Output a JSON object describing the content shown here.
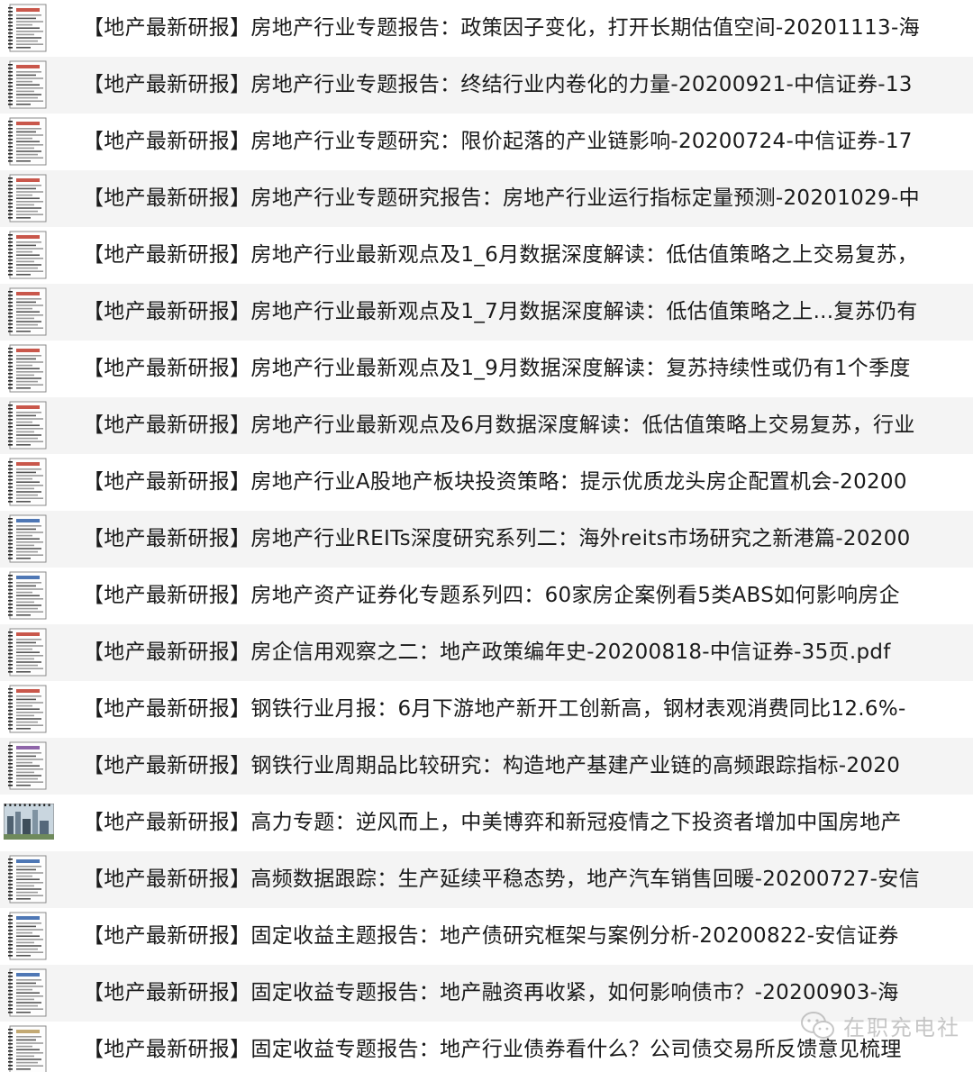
{
  "files": [
    {
      "name": "【地产最新研报】房地产行业专题报告：政策因子变化，打开长期估值空间-20201113-海",
      "thumb": "doc-red-icon"
    },
    {
      "name": "【地产最新研报】房地产行业专题报告：终结行业内卷化的力量-20200921-中信证券-13",
      "thumb": "doc-red-icon"
    },
    {
      "name": "【地产最新研报】房地产行业专题研究：限价起落的产业链影响-20200724-中信证券-17",
      "thumb": "doc-red-icon"
    },
    {
      "name": "【地产最新研报】房地产行业专题研究报告：房地产行业运行指标定量预测-20201029-中",
      "thumb": "doc-red-icon"
    },
    {
      "name": "【地产最新研报】房地产行业最新观点及1_6月数据深度解读：低估值策略之上交易复苏，",
      "thumb": "doc-red-icon"
    },
    {
      "name": "【地产最新研报】房地产行业最新观点及1_7月数据深度解读：低估值策略之上...复苏仍有",
      "thumb": "doc-red-icon"
    },
    {
      "name": "【地产最新研报】房地产行业最新观点及1_9月数据深度解读：复苏持续性或仍有1个季度",
      "thumb": "doc-red-icon"
    },
    {
      "name": "【地产最新研报】房地产行业最新观点及6月数据深度解读：低估值策略上交易复苏，行业",
      "thumb": "doc-red-icon"
    },
    {
      "name": "【地产最新研报】房地产行业A股地产板块投资策略：提示优质龙头房企配置机会-20200",
      "thumb": "doc-red-icon"
    },
    {
      "name": "【地产最新研报】房地产行业REITs深度研究系列二：海外reits市场研究之新港篇-20200",
      "thumb": "doc-blue-icon"
    },
    {
      "name": "【地产最新研报】房地产资产证券化专题系列四：60家房企案例看5类ABS如何影响房企",
      "thumb": "doc-blue-icon"
    },
    {
      "name": "【地产最新研报】房企信用观察之二：地产政策编年史-20200818-中信证券-35页.pdf",
      "thumb": "doc-red-icon"
    },
    {
      "name": "【地产最新研报】钢铁行业月报：6月下游地产新开工创新高，钢材表观消费同比12.6%-",
      "thumb": "doc-red-icon"
    },
    {
      "name": "【地产最新研报】钢铁行业周期品比较研究：构造地产基建产业链的高频跟踪指标-2020",
      "thumb": "doc-purple-icon"
    },
    {
      "name": "【地产最新研报】高力专题：逆风而上，中美博弈和新冠疫情之下投资者增加中国房地产",
      "thumb": "photo-thumbnail-icon"
    },
    {
      "name": "【地产最新研报】高频数据跟踪：生产延续平稳态势，地产汽车销售回暖-20200727-安信",
      "thumb": "doc-blue-icon"
    },
    {
      "name": "【地产最新研报】固定收益主题报告：地产债研究框架与案例分析-20200822-安信证券",
      "thumb": "doc-blue-icon"
    },
    {
      "name": "【地产最新研报】固定收益专题报告：地产融资再收紧，如何影响债市？-20200903-海",
      "thumb": "doc-blue-icon"
    },
    {
      "name": "【地产最新研报】固定收益专题报告：地产行业债券看什么？公司债交易所反馈意见梳理",
      "thumb": "doc-beige-icon"
    }
  ],
  "watermark": {
    "text": "在职充电社",
    "icon": "wechat-icon"
  }
}
